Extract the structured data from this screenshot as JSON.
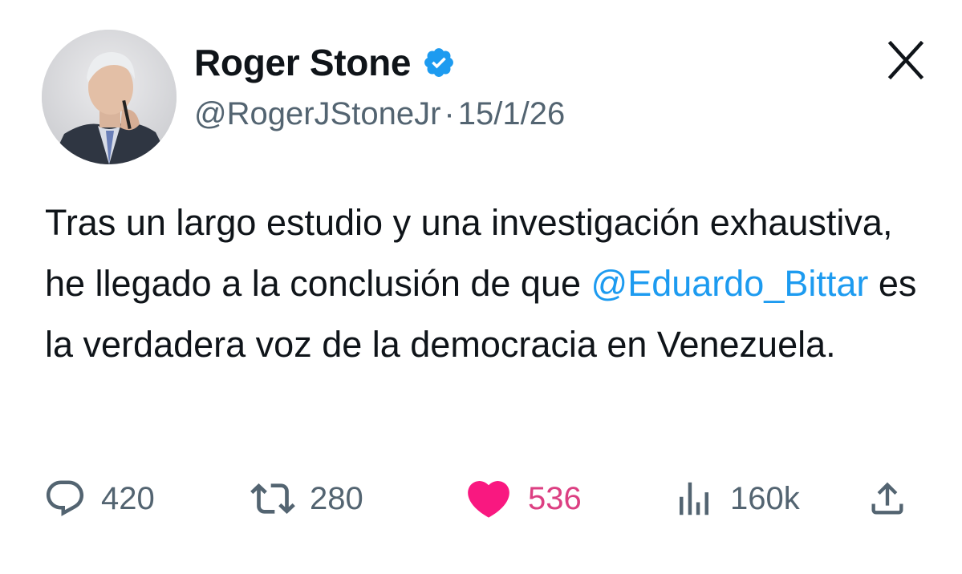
{
  "author": {
    "display_name": "Roger Stone",
    "handle": "@RogerJStoneJr",
    "separator": "·",
    "date": "15/1/26",
    "avatar_icon": "profile-photo",
    "verified_icon": "verified-badge-icon"
  },
  "brand": {
    "logo_text": "X"
  },
  "tweet": {
    "text_before": "Tras un largo estudio y una investigación exhaustiva, he llegado a la conclusión de que ",
    "mention": "@Eduardo_Bittar",
    "text_after": " es la verdadera voz de la democracia en Venezuela."
  },
  "actions": {
    "replies": {
      "icon": "reply-icon",
      "count": "420"
    },
    "retweets": {
      "icon": "retweet-icon",
      "count": "280"
    },
    "likes": {
      "icon": "heart-icon",
      "count": "536"
    },
    "views": {
      "icon": "views-icon",
      "count": "160k"
    },
    "share": {
      "icon": "share-icon"
    }
  },
  "colors": {
    "text": "#0f1419",
    "secondary": "#536471",
    "link": "#1d9bf0",
    "verified": "#1d9bf0",
    "like": "#f91880",
    "like_count": "#dc3f82"
  }
}
